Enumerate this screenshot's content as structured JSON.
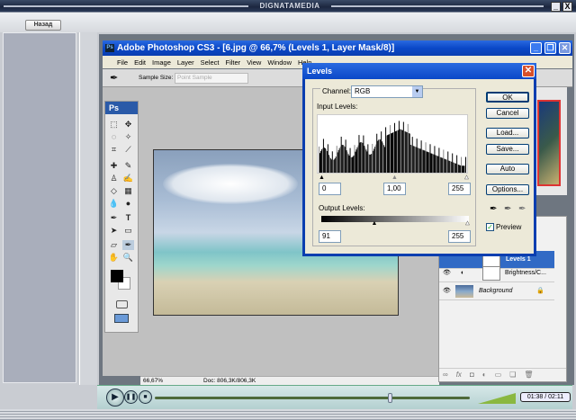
{
  "frame": {
    "brand": "DIGNATAMEDIA",
    "back_label": "Назад",
    "minimize": "_",
    "close": "X"
  },
  "photoshop": {
    "title": "Adobe Photoshop CS3 - [6.jpg @ 66,7% (Levels 1, Layer Mask/8)]",
    "menu": [
      "File",
      "Edit",
      "Image",
      "Layer",
      "Select",
      "Filter",
      "View",
      "Window",
      "Help"
    ],
    "options": {
      "sample_size_label": "Sample Size:",
      "sample_size_value": "Point Sample"
    },
    "toolbox_label": "Ps",
    "status": {
      "zoom": "66,67%",
      "doc": "Doc: 806,3K/806,3K"
    }
  },
  "levels": {
    "title": "Levels",
    "channel_label": "Channel:",
    "channel_value": "RGB",
    "input_label": "Input Levels:",
    "input_black": "0",
    "input_gamma": "1,00",
    "input_white": "255",
    "output_label": "Output Levels:",
    "output_black": "91",
    "output_white": "255",
    "output_black_fraction": 0.357,
    "buttons": {
      "ok": "OK",
      "cancel": "Cancel",
      "load": "Load...",
      "save": "Save...",
      "auto": "Auto",
      "options": "Options..."
    },
    "preview_label": "Preview",
    "preview_checked": true
  },
  "layers": [
    {
      "name": "Levels 1",
      "selected": true
    },
    {
      "name": "Brightness/C...",
      "selected": false
    },
    {
      "name": "Background",
      "selected": false,
      "locked": true
    }
  ],
  "player": {
    "time": "01:38 / 02:11",
    "progress": 0.75,
    "volume": 0.9
  }
}
